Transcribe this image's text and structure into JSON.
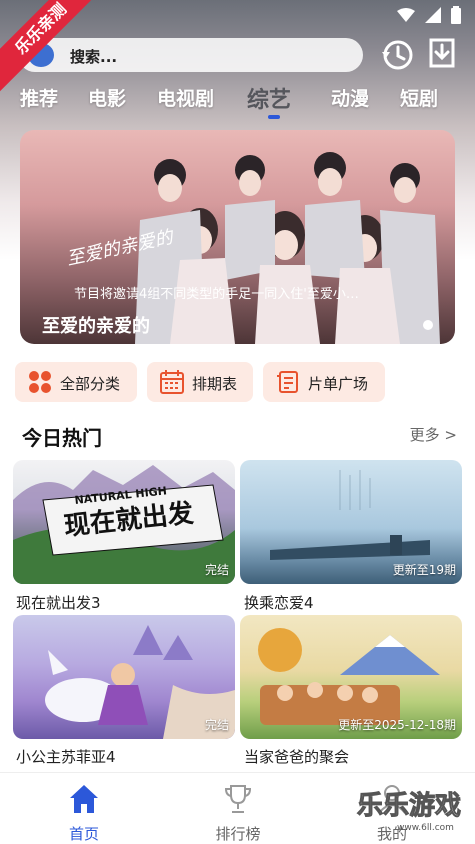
{
  "app": {
    "corner_ribbon": "乐乐亲测"
  },
  "search": {
    "placeholder": "搜索..."
  },
  "tabs": [
    {
      "label": "推荐"
    },
    {
      "label": "电影"
    },
    {
      "label": "电视剧"
    },
    {
      "label": "综艺",
      "active": true
    },
    {
      "label": "动漫"
    },
    {
      "label": "短剧"
    }
  ],
  "banner": {
    "caption": "节目将邀请4组不同类型的手足一同入住'至爱小…",
    "title": "至爱的亲爱的",
    "logo_text": "至爱的亲爱的"
  },
  "categories": [
    {
      "label": "全部分类",
      "icon": "grid-icon"
    },
    {
      "label": "排期表",
      "icon": "calendar-icon"
    },
    {
      "label": "片单广场",
      "icon": "list-icon"
    }
  ],
  "hot": {
    "title": "今日热门",
    "more": "更多 >",
    "items": [
      {
        "title": "现在就出发3",
        "badge": "完结",
        "art_text": "现在就出发",
        "art_sub": "NATURAL HIGH"
      },
      {
        "title": "换乘恋爱4",
        "badge": "更新至19期"
      },
      {
        "title": "小公主苏菲亚4",
        "badge": "完结"
      },
      {
        "title": "当家爸爸的聚会",
        "badge": "更新至2025-12-18期"
      }
    ]
  },
  "nav": [
    {
      "label": "首页",
      "icon": "home-icon",
      "active": true
    },
    {
      "label": "排行榜",
      "icon": "trophy-icon"
    },
    {
      "label": "我的",
      "icon": "user-icon"
    }
  ],
  "watermark": {
    "text": "乐乐游戏",
    "url": "www.6ll.com"
  },
  "colors": {
    "accent": "#2c58d9",
    "ribbon": "#e0263c",
    "chip_bg": "#fdeae3",
    "chip_icon": "#e8532e"
  }
}
